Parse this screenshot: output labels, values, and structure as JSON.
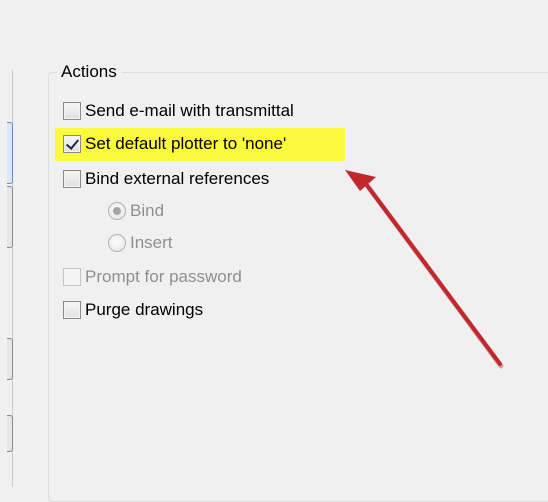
{
  "group": {
    "title": "Actions"
  },
  "options": {
    "send_email": {
      "label": "Send e-mail with transmittal",
      "checked": false,
      "enabled": true
    },
    "set_plotter": {
      "label": "Set default plotter to 'none'",
      "checked": true,
      "enabled": true
    },
    "bind_xrefs": {
      "label": "Bind external references",
      "checked": false,
      "enabled": true
    },
    "bind_type": {
      "bind": {
        "label": "Bind",
        "selected": true,
        "enabled": false
      },
      "insert": {
        "label": "Insert",
        "selected": false,
        "enabled": false
      }
    },
    "prompt_password": {
      "label": "Prompt for password",
      "checked": false,
      "enabled": false
    },
    "purge_drawings": {
      "label": "Purge drawings",
      "checked": false,
      "enabled": true
    }
  },
  "annotation": {
    "highlight_color": "#fbf93b",
    "arrow_color": "#c1272d"
  }
}
